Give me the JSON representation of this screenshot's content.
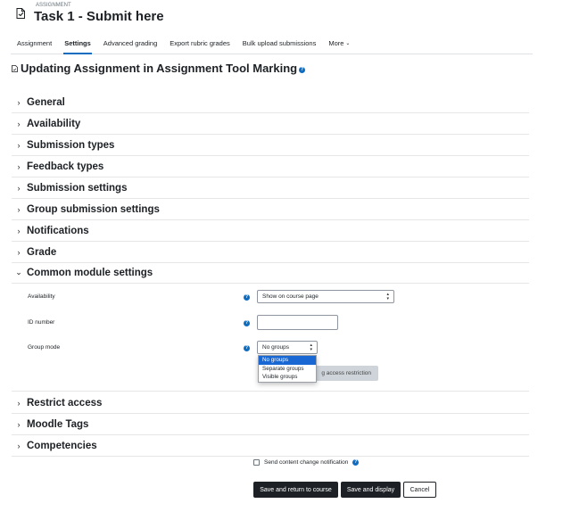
{
  "header": {
    "kicker": "ASSIGNMENT",
    "title": "Task 1 - Submit here"
  },
  "tabs": [
    {
      "label": "Assignment"
    },
    {
      "label": "Settings",
      "active": true
    },
    {
      "label": "Advanced grading"
    },
    {
      "label": "Export rubric grades"
    },
    {
      "label": "Bulk upload submissions"
    },
    {
      "label": "More",
      "caret": "⌄"
    }
  ],
  "page_heading": "Updating Assignment in Assignment Tool Marking",
  "sections": {
    "general": {
      "label": "General",
      "chevron": "›"
    },
    "availability": {
      "label": "Availability",
      "chevron": "›"
    },
    "submission_types": {
      "label": "Submission types",
      "chevron": "›"
    },
    "feedback_types": {
      "label": "Feedback types",
      "chevron": "›"
    },
    "submission_settings": {
      "label": "Submission settings",
      "chevron": "›"
    },
    "group_submission": {
      "label": "Group submission settings",
      "chevron": "›"
    },
    "notifications": {
      "label": "Notifications",
      "chevron": "›"
    },
    "grade": {
      "label": "Grade",
      "chevron": "›"
    },
    "common_module": {
      "label": "Common module settings",
      "chevron": "⌄"
    },
    "restrict_access": {
      "label": "Restrict access",
      "chevron": "›"
    },
    "moodle_tags": {
      "label": "Moodle Tags",
      "chevron": "›"
    },
    "competencies": {
      "label": "Competencies",
      "chevron": "›"
    }
  },
  "module_settings": {
    "availability_label": "Availability",
    "availability_value": "Show on course page",
    "id_number_label": "ID number",
    "id_number_value": "",
    "group_mode_label": "Group mode",
    "group_mode_value": "No groups",
    "group_mode_options": [
      "No groups",
      "Separate groups",
      "Visible groups"
    ],
    "restriction_button_label": "g access restriction",
    "help_glyph": "?"
  },
  "footer": {
    "notify_label": "Send content change notification",
    "save_return_label": "Save and return to course",
    "save_display_label": "Save and display",
    "cancel_label": "Cancel"
  },
  "colors": {
    "accent": "#0f6cbf",
    "selected_option": "#1967d2",
    "primary_button": "#1d2125"
  }
}
